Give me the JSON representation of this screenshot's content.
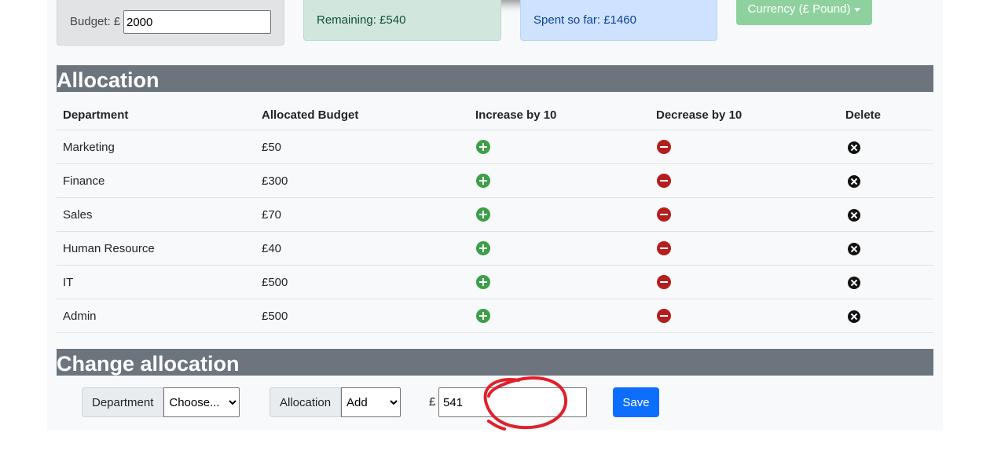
{
  "budget": {
    "label": "Budget: £",
    "value": "2000"
  },
  "remaining": {
    "text": "Remaining: £540"
  },
  "spent": {
    "text": "Spent so far: £1460"
  },
  "currency": {
    "label": "Currency (£ Pound)"
  },
  "allocation": {
    "title": "Allocation",
    "columns": [
      "Department",
      "Allocated Budget",
      "Increase by 10",
      "Decrease by 10",
      "Delete"
    ],
    "rows": [
      {
        "department": "Marketing",
        "budget": "£50"
      },
      {
        "department": "Finance",
        "budget": "£300"
      },
      {
        "department": "Sales",
        "budget": "£70"
      },
      {
        "department": "Human Resource",
        "budget": "£40"
      },
      {
        "department": "IT",
        "budget": "£500"
      },
      {
        "department": "Admin",
        "budget": "£500"
      }
    ]
  },
  "change": {
    "title": "Change allocation",
    "department_label": "Department",
    "department_selected": "Choose...",
    "allocation_label": "Allocation",
    "allocation_selected": "Add",
    "currency_symbol": "£",
    "amount": "541",
    "save_label": "Save"
  },
  "colors": {
    "section_header": "#6c757d",
    "increase_icon": "#3e9e49",
    "decrease_icon": "#b31f1f",
    "save_button": "#0d6efd",
    "annotation": "#e0202a"
  },
  "icons": {
    "increase": "plus-circle-icon",
    "decrease": "minus-circle-icon",
    "delete": "x-circle-icon"
  }
}
